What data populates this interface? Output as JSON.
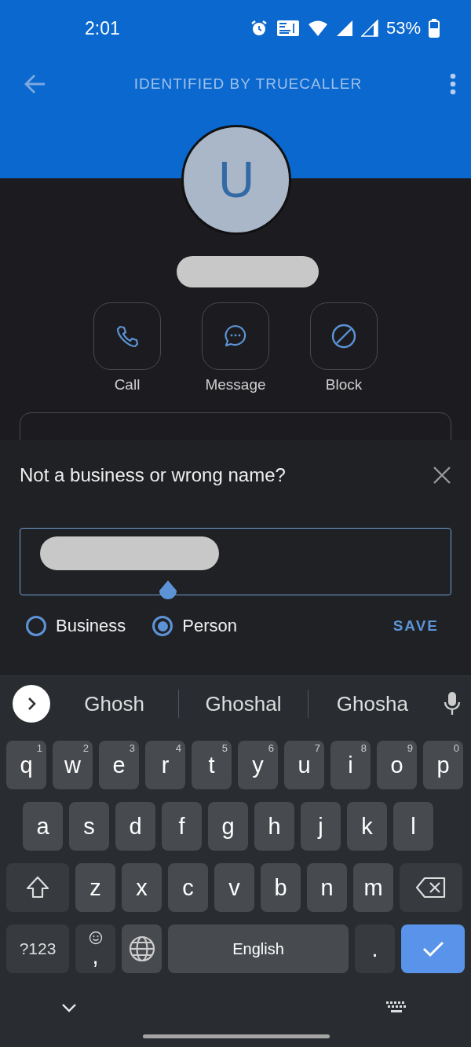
{
  "status_bar": {
    "time": "2:01",
    "battery": "53%"
  },
  "app_bar": {
    "title": "IDENTIFIED BY TRUECALLER"
  },
  "contact": {
    "avatar_letter": "U"
  },
  "actions": [
    {
      "kind": "call",
      "label": "Call"
    },
    {
      "kind": "message",
      "label": "Message"
    },
    {
      "kind": "block",
      "label": "Block"
    }
  ],
  "dialog": {
    "title": "Not a business or wrong name?",
    "options": [
      {
        "label": "Business",
        "selected": false
      },
      {
        "label": "Person",
        "selected": true
      }
    ],
    "save": "SAVE"
  },
  "keyboard": {
    "suggestions": [
      "Ghosh",
      "Ghoshal",
      "Ghosha"
    ],
    "key_rows": [
      {
        "keys": [
          {
            "kind": "char",
            "label": "q",
            "hint": "1"
          },
          {
            "kind": "char",
            "label": "w",
            "hint": "2"
          },
          {
            "kind": "char",
            "label": "e",
            "hint": "3"
          },
          {
            "kind": "char",
            "label": "r",
            "hint": "4"
          },
          {
            "kind": "char",
            "label": "t",
            "hint": "5"
          },
          {
            "kind": "char",
            "label": "y",
            "hint": "6"
          },
          {
            "kind": "char",
            "label": "u",
            "hint": "7"
          },
          {
            "kind": "char",
            "label": "i",
            "hint": "8"
          },
          {
            "kind": "char",
            "label": "o",
            "hint": "9"
          },
          {
            "kind": "char",
            "label": "p",
            "hint": "0"
          }
        ]
      },
      {
        "keys": [
          {
            "kind": "char",
            "label": "a"
          },
          {
            "kind": "char",
            "label": "s"
          },
          {
            "kind": "char",
            "label": "d"
          },
          {
            "kind": "char",
            "label": "f"
          },
          {
            "kind": "char",
            "label": "g"
          },
          {
            "kind": "char",
            "label": "h"
          },
          {
            "kind": "char",
            "label": "j"
          },
          {
            "kind": "char",
            "label": "k"
          },
          {
            "kind": "char",
            "label": "l"
          }
        ]
      },
      {
        "keys": [
          {
            "kind": "shift"
          },
          {
            "kind": "char",
            "label": "z"
          },
          {
            "kind": "char",
            "label": "x"
          },
          {
            "kind": "char",
            "label": "c"
          },
          {
            "kind": "char",
            "label": "v"
          },
          {
            "kind": "char",
            "label": "b"
          },
          {
            "kind": "char",
            "label": "n"
          },
          {
            "kind": "char",
            "label": "m"
          },
          {
            "kind": "backspace"
          }
        ]
      },
      {
        "keys": [
          {
            "kind": "symbols",
            "label": "?123"
          },
          {
            "kind": "emoji",
            "label": ","
          },
          {
            "kind": "globe"
          },
          {
            "kind": "space",
            "label": "English"
          },
          {
            "kind": "punct",
            "label": "."
          },
          {
            "kind": "enter"
          }
        ]
      }
    ]
  }
}
